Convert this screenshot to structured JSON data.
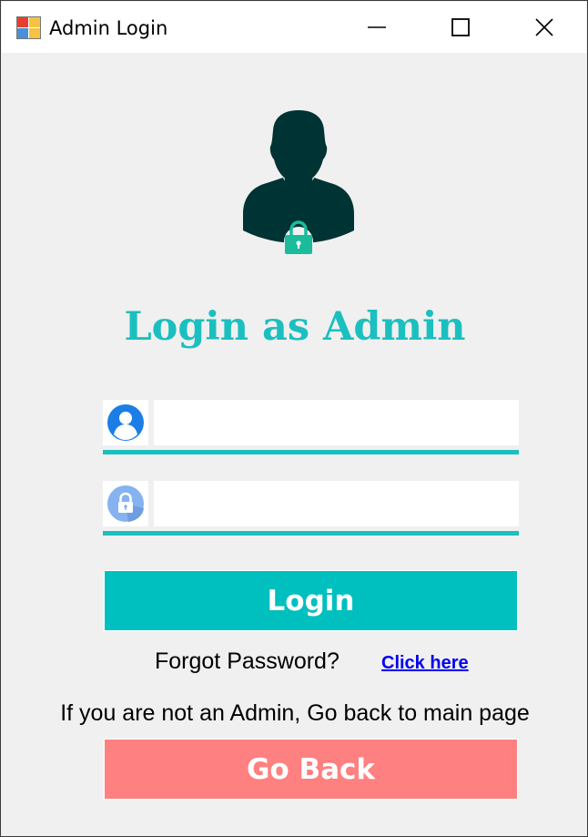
{
  "window": {
    "title": "Admin Login"
  },
  "login_form": {
    "heading": "Login as Admin",
    "username": {
      "value": "",
      "placeholder": ""
    },
    "password": {
      "value": "",
      "placeholder": ""
    },
    "login_label": "Login",
    "forgot_text": "Forgot Password?",
    "click_here_label": "Click here"
  },
  "footer": {
    "notice": "If you are not an Admin, Go back to main page",
    "go_back_label": "Go Back"
  },
  "colors": {
    "accent": "#1cbfbf",
    "login_button": "#00bfbf",
    "go_back_button": "#ff8080",
    "avatar": "#003333",
    "lock_badge": "#1abc9c",
    "link": "#0000ee"
  },
  "icons": {
    "app": "app-windows-icon",
    "avatar": "admin-user-lock-icon",
    "username": "user-circle-icon",
    "password": "lock-circle-icon"
  }
}
